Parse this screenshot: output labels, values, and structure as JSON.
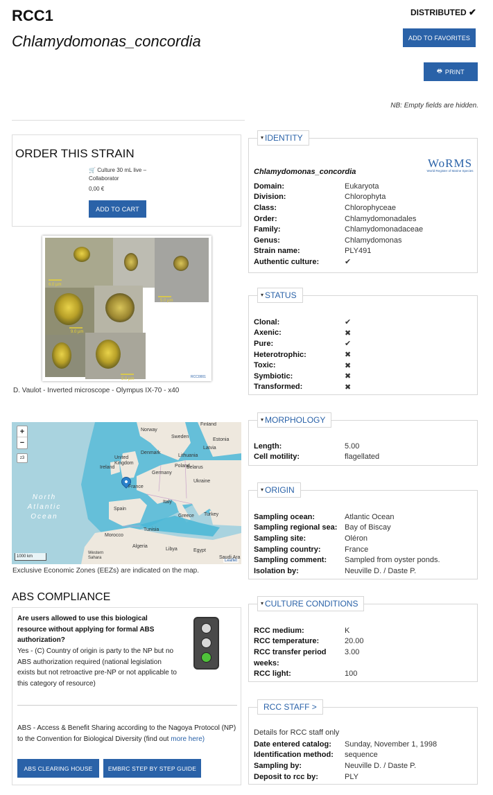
{
  "header": {
    "strain_id": "RCC1",
    "species": "Chlamydomonas_concordia",
    "distributed_label": "DISTRIBUTED",
    "distributed_icon": "check-icon",
    "add_favorites_label": "ADD TO FAVORITES",
    "print_label": "PRINT",
    "note": "NB: Empty fields are hidden."
  },
  "order": {
    "title": "ORDER THIS STRAIN",
    "product_line1": "Culture 30 mL live –",
    "product_line2": "Collaborator",
    "price": "0,00 €",
    "add_to_cart_label": "ADD TO CART"
  },
  "image": {
    "caption": "D. Vaulot - Inverted microscope - Olympus IX-70 - x40",
    "scale_labels": [
      "6.0 µm",
      "5.0 µm",
      "9.0 µm",
      "5.0 µm"
    ],
    "watermark": "RCC0001"
  },
  "map": {
    "zoom_in": "+",
    "zoom_out": "−",
    "layers_label": "z3",
    "scale_label": "1000 km",
    "attribution": "Leaflet",
    "caption": "Exclusive Economic Zones (EEZs) are indicated on the map.",
    "labels": {
      "norway": "Norway",
      "finland": "Finland",
      "sweden": "Sweden",
      "estonia": "Estonia",
      "latvia": "Latvia",
      "denmark": "Denmark",
      "lithuania": "Lithuania",
      "uk": "United Kingdom",
      "ireland": "Ireland",
      "poland": "Poland",
      "belarus": "Belarus",
      "germany": "Germany",
      "ukraine": "Ukraine",
      "france": "France",
      "spain": "Spain",
      "italy": "Italy",
      "greece": "Greece",
      "turkey": "Turkey",
      "tunisia": "Tunisia",
      "morocco": "Morocco",
      "algeria": "Algeria",
      "libya": "Libya",
      "egypt": "Egypt",
      "western_sahara": "Western Sahara",
      "saudi": "Saudi Ara",
      "ocean1": "North",
      "ocean2": "Atlantic",
      "ocean3": "Ocean"
    }
  },
  "abs": {
    "title": "ABS COMPLIANCE",
    "question": "Are users allowed to use this biological resource without applying for formal ABS authorization?",
    "answer": "Yes - (C) Country of origin is party to the NP but no ABS authorization required (national legislation exists but not retroactive pre-NP or not applicable to this category of resource)",
    "footer_text": "ABS - Access & Benefit Sharing according to the Nagoya Protocol (NP) to the Convention for Biological Diversity (find out",
    "more_here": "more here)",
    "light_state": "green",
    "clearing_house_label": "ABS CLEARING HOUSE",
    "embrc_label": "EMBRC STEP BY STEP GUIDE"
  },
  "identity": {
    "tab_label": "IDENTITY",
    "species": "Chlamydomonas_concordia",
    "worms_logo": "WoRMS",
    "worms_tagline": "World Register of Marine Species",
    "fields": [
      {
        "k": "Domain:",
        "v": "Eukaryota"
      },
      {
        "k": "Division:",
        "v": "Chlorophyta"
      },
      {
        "k": "Class:",
        "v": "Chlorophyceae"
      },
      {
        "k": "Order:",
        "v": "Chlamydomonadales"
      },
      {
        "k": "Family:",
        "v": "Chlamydomonadaceae"
      },
      {
        "k": "Genus:",
        "v": "Chlamydomonas"
      },
      {
        "k": "Strain name:",
        "v": "PLY491"
      },
      {
        "k": "Authentic culture:",
        "v": "✔"
      }
    ]
  },
  "status": {
    "tab_label": "STATUS",
    "fields": [
      {
        "k": "Clonal:",
        "v": "✔"
      },
      {
        "k": "Axenic:",
        "v": "✖"
      },
      {
        "k": "Pure:",
        "v": "✔"
      },
      {
        "k": "Heterotrophic:",
        "v": "✖"
      },
      {
        "k": "Toxic:",
        "v": "✖"
      },
      {
        "k": "Symbiotic:",
        "v": "✖"
      },
      {
        "k": "Transformed:",
        "v": "✖"
      }
    ]
  },
  "morphology": {
    "tab_label": "MORPHOLOGY",
    "fields": [
      {
        "k": "Length:",
        "v": "5.00"
      },
      {
        "k": "Cell motility:",
        "v": "flagellated"
      }
    ]
  },
  "origin": {
    "tab_label": "ORIGIN",
    "fields": [
      {
        "k": "Sampling ocean:",
        "v": "Atlantic Ocean"
      },
      {
        "k": "Sampling regional sea:",
        "v": "Bay of Biscay"
      },
      {
        "k": "Sampling site:",
        "v": "Oléron"
      },
      {
        "k": "Sampling country:",
        "v": "France"
      },
      {
        "k": "Sampling comment:",
        "v": "Sampled from oyster ponds."
      },
      {
        "k": "Isolation by:",
        "v": "Neuville D. / Daste P."
      }
    ]
  },
  "culture": {
    "tab_label": "CULTURE CONDITIONS",
    "medium_k": "RCC medium:",
    "medium_v": "K",
    "temp_k": "RCC temperature:",
    "temp_v": "20.00",
    "period_k1": "RCC transfer period",
    "period_k2": "weeks:",
    "period_v": "3.00",
    "light_k": "RCC light:",
    "light_v": "100"
  },
  "staff": {
    "tab_label": "RCC STAFF >",
    "intro": "Details for RCC staff only",
    "fields": [
      {
        "k": "Date entered catalog:",
        "v": "Sunday, November 1, 1998"
      },
      {
        "k": "Identification method:",
        "v": "sequence"
      },
      {
        "k": "Sampling by:",
        "v": "Neuville D. / Daste P."
      },
      {
        "k": "Deposit to rcc by:",
        "v": "PLY"
      }
    ]
  }
}
